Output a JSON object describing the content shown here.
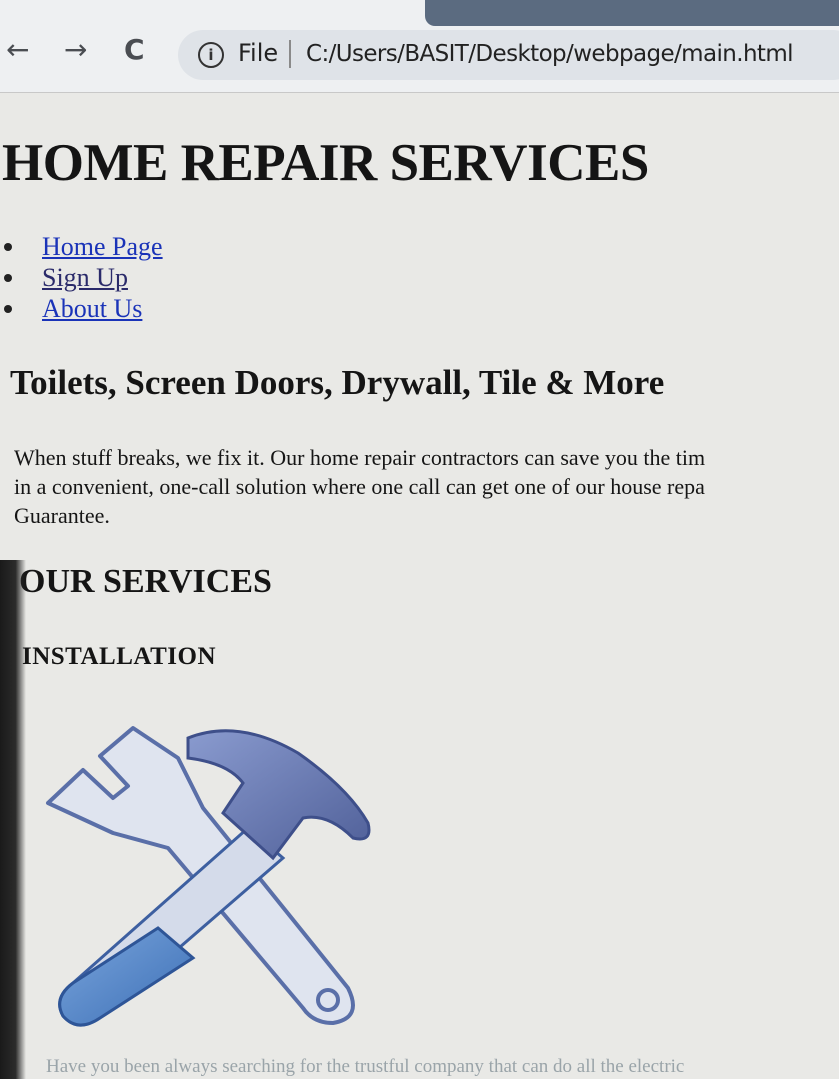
{
  "browser": {
    "back_icon": "←",
    "forward_icon": "→",
    "reload_icon": "C",
    "info_icon": "i",
    "file_label": "File",
    "url": "C:/Users/BASIT/Desktop/webpage/main.html"
  },
  "page": {
    "title": "HOME REPAIR SERVICES",
    "nav": [
      {
        "label": "Home Page"
      },
      {
        "label": "Sign Up"
      },
      {
        "label": "About Us"
      }
    ],
    "headline": "Toilets, Screen Doors, Drywall, Tile & More",
    "intro_lines": [
      "When stuff breaks, we fix it. Our home repair contractors can save you the tim",
      "in a convenient, one-call solution where one call can get one of our house repa",
      "Guarantee."
    ],
    "services_heading": "OUR SERVICES",
    "installation_heading": "INSTALLATION",
    "installation_image_icon": "wrench-hammer-icon",
    "footer_text": "Have you been always searching for the trustful company that can do all the electric"
  },
  "colors": {
    "link": "#1a33b8",
    "image_blue": "#4b7fc4",
    "image_light": "#d6dcea"
  }
}
